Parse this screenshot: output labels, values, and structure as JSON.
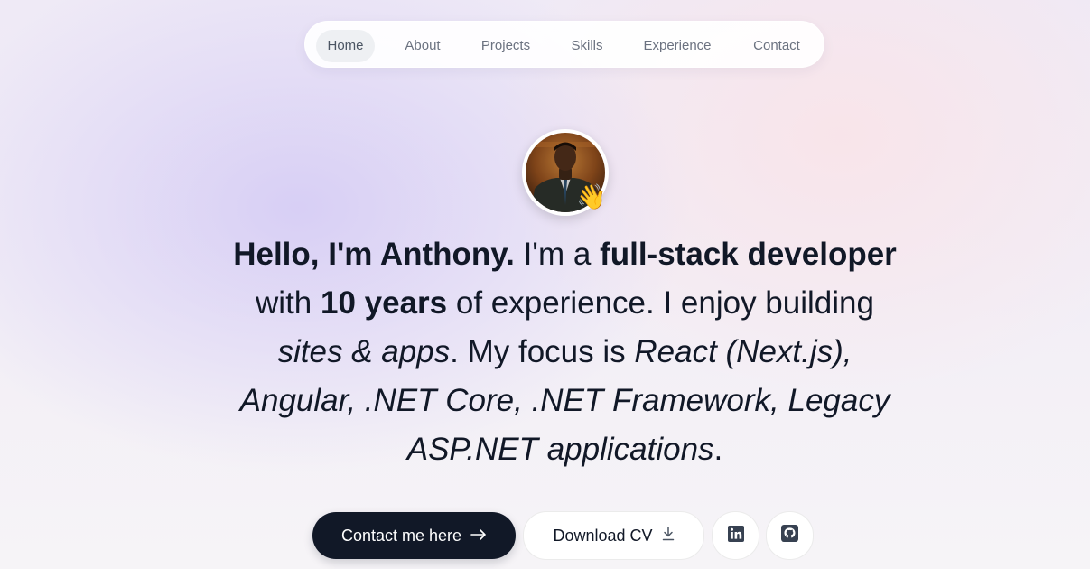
{
  "nav": {
    "items": [
      {
        "label": "Home",
        "active": true
      },
      {
        "label": "About",
        "active": false
      },
      {
        "label": "Projects",
        "active": false
      },
      {
        "label": "Skills",
        "active": false
      },
      {
        "label": "Experience",
        "active": false
      },
      {
        "label": "Contact",
        "active": false
      }
    ]
  },
  "hero": {
    "avatar_icon": "profile-photo",
    "wave_emoji": "👋",
    "intro": {
      "greeting": "Hello, I'm Anthony.",
      "t1": " I'm a ",
      "role": "full-stack developer",
      "t2": " with ",
      "years": "10 years",
      "t3": " of experience. I enjoy building ",
      "build": "sites & apps",
      "t4": ". My focus is ",
      "focus": "React (Next.js), Angular, .NET Core, .NET Framework, Legacy ASP.NET applications",
      "t5": "."
    }
  },
  "actions": {
    "contact_label": "Contact me here",
    "contact_icon": "arrow-right-icon",
    "cv_label": "Download CV",
    "cv_icon": "download-icon",
    "linkedin_icon": "linkedin-icon",
    "github_icon": "github-icon"
  },
  "colors": {
    "primary": "#111827",
    "nav_active_bg": "#eef0f3",
    "nav_text": "#6b7280"
  }
}
